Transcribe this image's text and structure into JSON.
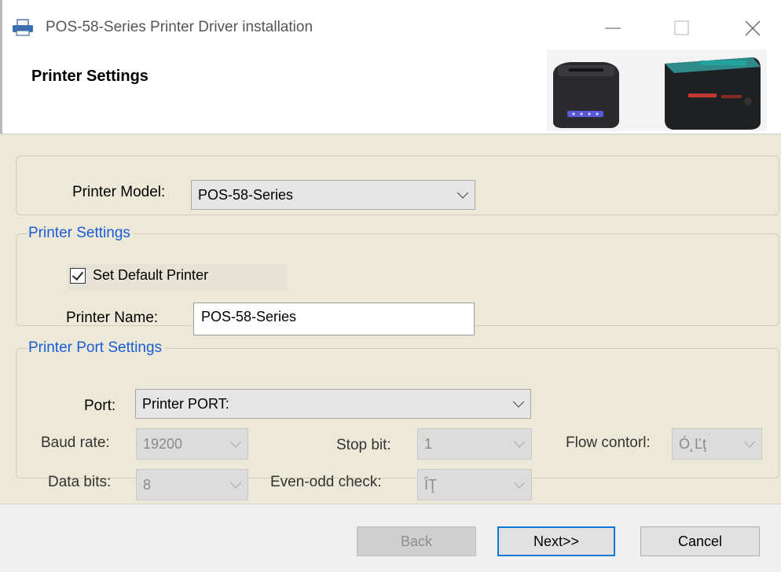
{
  "window": {
    "title": "POS-58-Series Printer Driver installation",
    "controls": {
      "minimize": "—",
      "maximize": "☐",
      "close": "✕"
    }
  },
  "header": {
    "title": "Printer Settings"
  },
  "model_group": {
    "label": "Printer Model:",
    "selected": "POS-58-Series"
  },
  "settings_group": {
    "legend": "Printer Settings",
    "set_default_label": "Set Default Printer",
    "set_default_checked": true,
    "name_label": "Printer Name:",
    "name_value": "POS-58-Series"
  },
  "port_group": {
    "legend": "Printer Port Settings",
    "port_label": "Port:",
    "port_value": "Printer PORT:",
    "baud_label": "Baud rate:",
    "baud_value": "19200",
    "stop_label": "Stop bit:",
    "stop_value": "1",
    "flow_label": "Flow contorl:",
    "flow_value": "Ó˛Ľţ",
    "databits_label": "Data bits:",
    "databits_value": "8",
    "parity_label": "Even-odd check:",
    "parity_value": "ÎŢ"
  },
  "footer": {
    "back_label": "Back",
    "next_label": "Next>>",
    "cancel_label": "Cancel"
  },
  "colors": {
    "panel_bg": "#ece9d8",
    "legend_blue": "#1a5bd6",
    "focus_blue": "#0a78d7"
  }
}
